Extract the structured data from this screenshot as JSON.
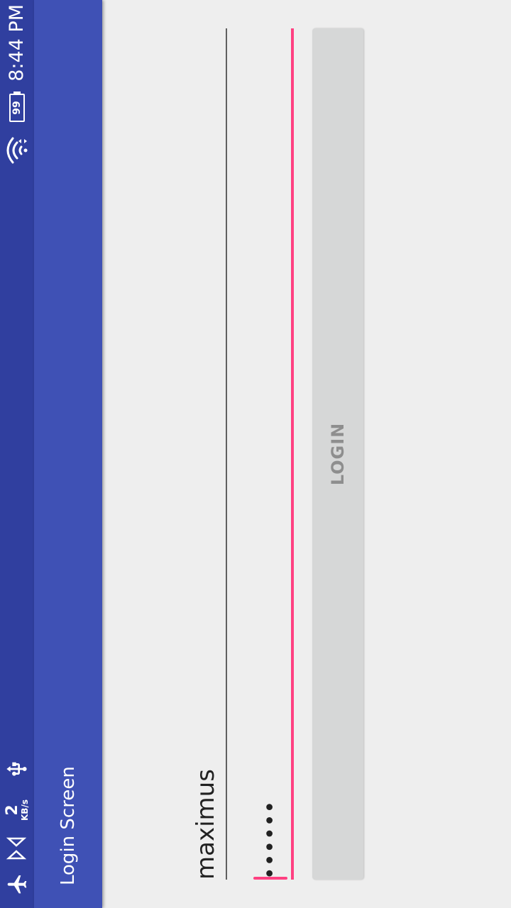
{
  "status_bar": {
    "time": "8:44 PM",
    "battery_level": "99",
    "net_speed_value": "2",
    "net_speed_unit": "KB/s",
    "icons": [
      "airplane-mode-icon",
      "data-transfer-icon",
      "usb-icon",
      "wifi-icon",
      "battery-icon"
    ]
  },
  "toolbar": {
    "title": "Login Screen"
  },
  "form": {
    "username_value": "maximus",
    "password_value": "••••••",
    "login_label": "LOGIN"
  },
  "colors": {
    "status_bar": "#303f9f",
    "toolbar": "#3f51b5",
    "accent": "#ff4081",
    "background": "#eeeeee",
    "button": "#d6d7d7"
  }
}
